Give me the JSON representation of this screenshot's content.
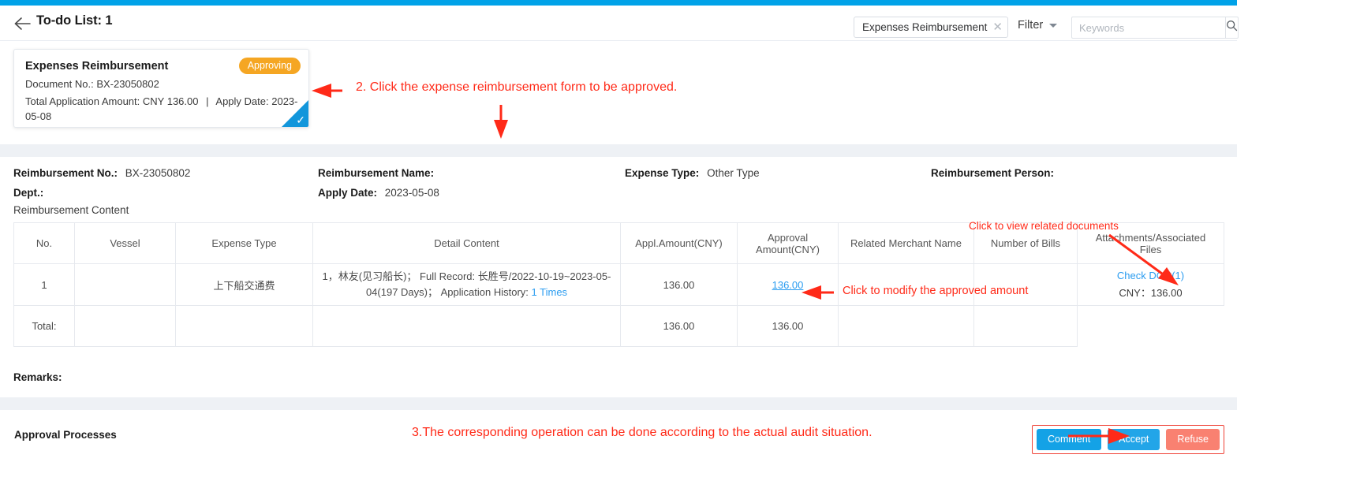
{
  "header": {
    "back_icon": "back-arrow-icon",
    "title": "To-do List: 1",
    "filter_chip": "Expenses Reimbursement",
    "filter_chip_close": "✕",
    "filter_label": "Filter",
    "search_placeholder": "Keywords",
    "search_value": "",
    "search_icon": "search-icon"
  },
  "card": {
    "title": "Expenses Reimbursement",
    "status": "Approving",
    "doc_no_label": "Document No.:",
    "doc_no_value": "BX-23050802",
    "total_label": "Total Application Amount:",
    "total_value": "CNY 136.00",
    "divider": "|",
    "apply_date_label": "Apply Date:",
    "apply_date_value": "2023-05-08",
    "selected_mark": "✓"
  },
  "detail": {
    "reimb_no_label": "Reimbursement No.",
    "reimb_no_value": "BX-23050802",
    "dept_label": "Dept.",
    "dept_value": "",
    "reimb_name_label": "Reimbursement Name",
    "reimb_name_value": "",
    "apply_date_label": "Apply Date",
    "apply_date_value": "2023-05-08",
    "expense_type_label": "Expense Type",
    "expense_type_value": "Other Type",
    "reimb_person_label": "Reimbursement Person",
    "reimb_person_value": "",
    "content_label": "Reimbursement Content",
    "remarks_label": "Remarks:"
  },
  "table": {
    "columns": [
      "No.",
      "Vessel",
      "Expense Type",
      "Detail Content",
      "Appl.Amount(CNY)",
      "Approval Amount(CNY)",
      "Related Merchant Name",
      "Number of Bills",
      "Attachments/Associated Files"
    ],
    "rows": [
      {
        "no": "1",
        "vessel": "",
        "expense_type": "上下船交通费",
        "detail_prefix": "1，",
        "detail_person": "林友(见习船长)；",
        "detail_record_label": "Full Record:",
        "detail_record_value": "长胜号/2022-10-19~2023-05-04(197 Days)；",
        "detail_history_label": "Application History:",
        "detail_history_link": "1 Times",
        "appl_amount": "136.00",
        "approval_amount": "136.00",
        "merchant": "",
        "bills": "",
        "attachment_link": "Check DOC(1)",
        "attachment_amount": "CNY：136.00"
      }
    ],
    "total": {
      "label": "Total:",
      "vessel": "",
      "expense_type": "",
      "detail": "",
      "appl_amount": "136.00",
      "approval_amount": "136.00",
      "merchant": "",
      "bills": "",
      "attachment": ""
    }
  },
  "footer": {
    "approval_title": "Approval Processes",
    "comment_label": "Comment",
    "accept_label": "Accept",
    "refuse_label": "Refuse"
  },
  "annotations": {
    "step2": "2. Click the expense reimbursement form to be approved.",
    "view_docs": "Click to view related documents",
    "modify_amount": "Click to modify the approved amount",
    "step3": "3.The corresponding operation can be done according to the actual audit situation."
  },
  "colors": {
    "accent_blue": "#00a2e8",
    "badge_orange": "#f5a623",
    "annotation_red": "#ff2a18",
    "link_blue": "#2a9cf0",
    "refuse_red": "#f98171"
  }
}
